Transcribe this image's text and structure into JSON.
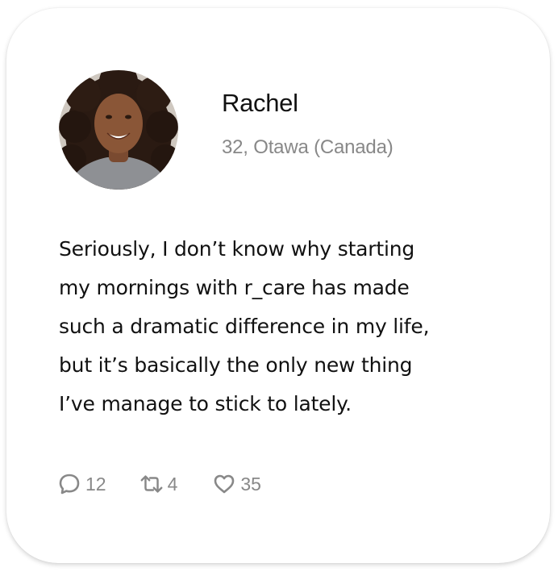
{
  "post": {
    "author": {
      "name": "Rachel",
      "meta": "32, Otawa (Canada)",
      "avatar_icon": "user-photo"
    },
    "text_lines": [
      "Seriously, I don’t know why starting",
      "my mornings with r_care has made",
      "such a dramatic difference in my life,",
      "but it’s basically the only new thing",
      "I’ve manage to stick to lately."
    ],
    "actions": {
      "replies": {
        "icon": "comment-icon",
        "count": "12"
      },
      "reposts": {
        "icon": "repost-icon",
        "count": "4"
      },
      "likes": {
        "icon": "heart-icon",
        "count": "35"
      }
    }
  },
  "colors": {
    "text_primary": "#111111",
    "text_secondary": "#888888",
    "card_background": "#ffffff"
  }
}
